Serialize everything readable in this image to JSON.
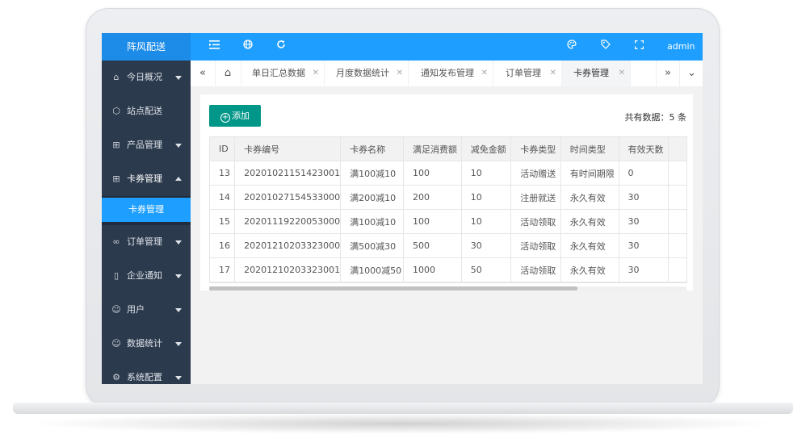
{
  "app": {
    "title": "阵风配送"
  },
  "header": {
    "icons": [
      "menu-icon",
      "globe-icon",
      "refresh-icon",
      "palette-icon",
      "tag-icon",
      "fullscreen-icon"
    ],
    "user": "admin"
  },
  "sidebar": {
    "items": [
      {
        "label": "今日概况",
        "icon": "home-icon"
      },
      {
        "label": "站点配送",
        "icon": "cube-icon"
      },
      {
        "label": "产品管理",
        "icon": "apps-icon"
      },
      {
        "label": "卡券管理",
        "icon": "apps-icon",
        "expanded": true
      },
      {
        "label": "订单管理",
        "icon": "infinity-icon"
      },
      {
        "label": "企业通知",
        "icon": "note-icon"
      },
      {
        "label": "用户",
        "icon": "user-icon"
      },
      {
        "label": "数据统计",
        "icon": "user-icon"
      },
      {
        "label": "系统配置",
        "icon": "gear-icon"
      }
    ],
    "active_sub": "卡券管理"
  },
  "tabs": [
    {
      "label": "单日汇总数据"
    },
    {
      "label": "月度数据统计"
    },
    {
      "label": "通知发布管理"
    },
    {
      "label": "订单管理"
    },
    {
      "label": "卡券管理",
      "active": true
    }
  ],
  "toolbar": {
    "add_label": "添加",
    "total_text": "共有数据：5 条"
  },
  "table": {
    "columns": [
      "ID",
      "卡券编号",
      "卡券名称",
      "满足消费额",
      "减免金额",
      "卡券类型",
      "时间类型",
      "有效天数"
    ],
    "rows": [
      [
        "13",
        "20201021151423001",
        "满100减10",
        "100",
        "10",
        "活动赠送",
        "有时间期限",
        "0"
      ],
      [
        "14",
        "20201027154533000",
        "满200减10",
        "200",
        "10",
        "注册就送",
        "永久有效",
        "30"
      ],
      [
        "15",
        "20201119220053000",
        "满100减10",
        "100",
        "10",
        "活动领取",
        "永久有效",
        "30"
      ],
      [
        "16",
        "20201210203323000",
        "满500减30",
        "500",
        "30",
        "活动领取",
        "永久有效",
        "30"
      ],
      [
        "17",
        "20201210203323001",
        "满1000减50",
        "1000",
        "50",
        "活动领取",
        "永久有效",
        "30"
      ]
    ]
  },
  "colors": {
    "header": "#1e9fff",
    "sidebar": "#2b3a4d",
    "accent": "#009688"
  }
}
